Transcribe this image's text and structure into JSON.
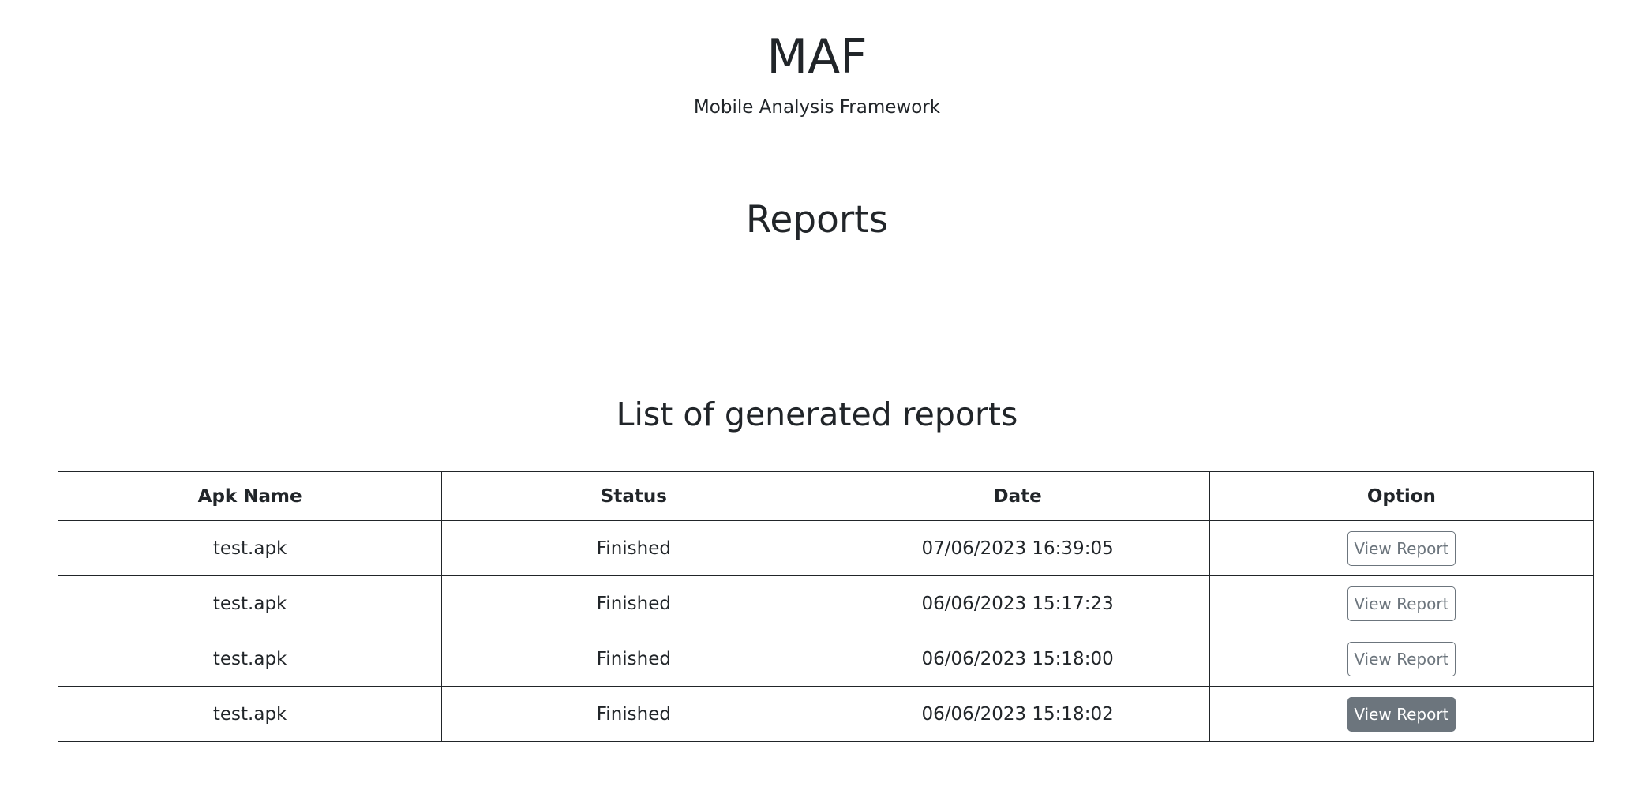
{
  "header": {
    "title": "MAF",
    "subtitle": "Mobile Analysis Framework"
  },
  "page": {
    "heading": "Reports",
    "section_heading": "List of generated reports"
  },
  "table": {
    "columns": [
      "Apk Name",
      "Status",
      "Date",
      "Option"
    ],
    "rows": [
      {
        "apk_name": "test.apk",
        "status": "Finished",
        "date": "07/06/2023 16:39:05",
        "option": "View Report",
        "hovered": false
      },
      {
        "apk_name": "test.apk",
        "status": "Finished",
        "date": "06/06/2023 15:17:23",
        "option": "View Report",
        "hovered": false
      },
      {
        "apk_name": "test.apk",
        "status": "Finished",
        "date": "06/06/2023 15:18:00",
        "option": "View Report",
        "hovered": false
      },
      {
        "apk_name": "test.apk",
        "status": "Finished",
        "date": "06/06/2023 15:18:02",
        "option": "View Report",
        "hovered": true
      }
    ]
  },
  "colors": {
    "text": "#212529",
    "button_secondary": "#6c757d",
    "background": "#ffffff"
  }
}
